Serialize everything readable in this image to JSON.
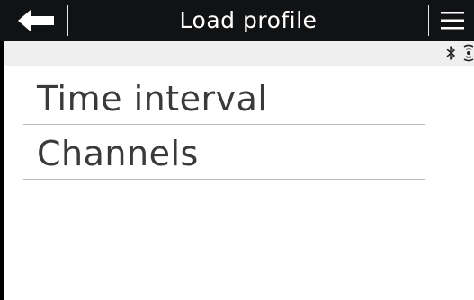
{
  "header": {
    "title": "Load profile",
    "back_icon": "arrow-left-icon",
    "menu_icon": "hamburger-menu-icon"
  },
  "status_bar": {
    "icons": [
      "bluetooth-icon",
      "signal-icon"
    ]
  },
  "menu": {
    "items": [
      {
        "label": "Time interval"
      },
      {
        "label": "Channels"
      }
    ]
  },
  "colors": {
    "header_bg": "#111214",
    "status_bg": "#efefef",
    "text": "#3a3a3a",
    "divider": "#bdbdbd"
  }
}
